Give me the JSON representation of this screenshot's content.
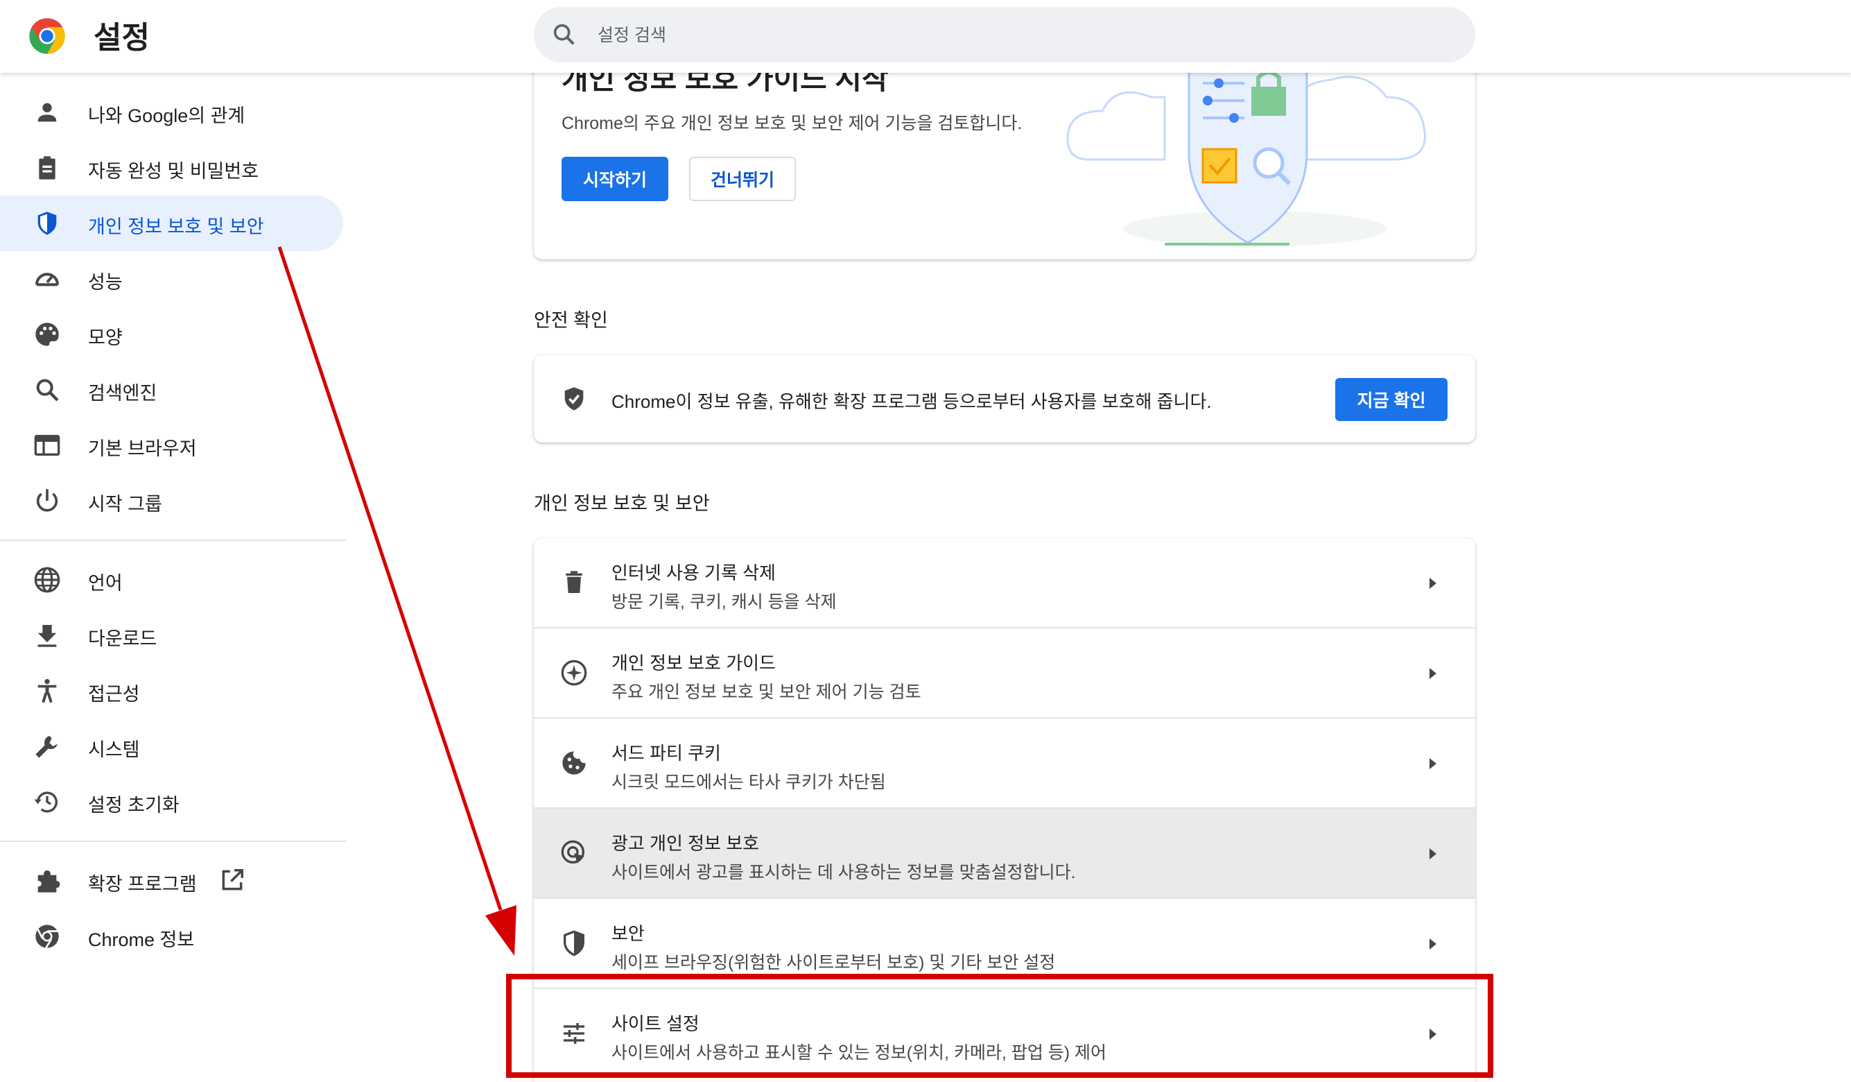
{
  "app": {
    "title": "설정"
  },
  "search": {
    "placeholder": "설정 검색"
  },
  "sidebar": {
    "items": [
      {
        "label": "나와 Google의 관계",
        "icon": "person-icon"
      },
      {
        "label": "자동 완성 및 비밀번호",
        "icon": "clipboard-icon"
      },
      {
        "label": "개인 정보 보호 및 보안",
        "icon": "shield-icon",
        "active": true
      },
      {
        "label": "성능",
        "icon": "speedometer-icon"
      },
      {
        "label": "모양",
        "icon": "palette-icon"
      },
      {
        "label": "검색엔진",
        "icon": "search-icon"
      },
      {
        "label": "기본 브라우저",
        "icon": "browser-window-icon"
      },
      {
        "label": "시작 그룹",
        "icon": "power-icon"
      },
      {
        "label": "언어",
        "icon": "globe-icon"
      },
      {
        "label": "다운로드",
        "icon": "download-icon"
      },
      {
        "label": "접근성",
        "icon": "accessibility-icon"
      },
      {
        "label": "시스템",
        "icon": "wrench-icon"
      },
      {
        "label": "설정 초기화",
        "icon": "history-icon"
      },
      {
        "label": "확장 프로그램",
        "icon": "puzzle-icon"
      },
      {
        "label": "Chrome 정보",
        "icon": "chrome-icon"
      }
    ]
  },
  "guide": {
    "title": "개인 정보 보호 가이드 시작",
    "description": "Chrome의 주요 개인 정보 보호 및 보안 제어 기능을 검토합니다.",
    "start_label": "시작하기",
    "skip_label": "건너뛰기"
  },
  "safety": {
    "section_title": "안전 확인",
    "text": "Chrome이 정보 유출, 유해한 확장 프로그램 등으로부터 사용자를 보호해 줍니다.",
    "button_label": "지금 확인"
  },
  "privacy": {
    "section_title": "개인 정보 보호 및 보안",
    "rows": [
      {
        "title": "인터넷 사용 기록 삭제",
        "subtitle": "방문 기록, 쿠키, 캐시 등을 삭제",
        "icon": "trash-icon"
      },
      {
        "title": "개인 정보 보호 가이드",
        "subtitle": "주요 개인 정보 보호 및 보안 제어 기능 검토",
        "icon": "compass-icon"
      },
      {
        "title": "서드 파티 쿠키",
        "subtitle": "시크릿 모드에서는 타사 쿠키가 차단됨",
        "icon": "cookie-icon"
      },
      {
        "title": "광고 개인 정보 보호",
        "subtitle": "사이트에서 광고를 표시하는 데 사용하는 정보를 맞춤설정합니다.",
        "icon": "ad-privacy-icon",
        "hover": true
      },
      {
        "title": "보안",
        "subtitle": "세이프 브라우징(위험한 사이트로부터 보호) 및 기타 보안 설정",
        "icon": "security-shield-icon"
      },
      {
        "title": "사이트 설정",
        "subtitle": "사이트에서 사용하고 표시할 수 있는 정보(위치, 카메라, 팝업 등) 제어",
        "icon": "tune-sliders-icon"
      }
    ]
  },
  "colors": {
    "accent": "#1a73e8",
    "active_bg": "#e8f0fe",
    "active_text": "#0b57d0",
    "annotation_red": "#d50000"
  }
}
